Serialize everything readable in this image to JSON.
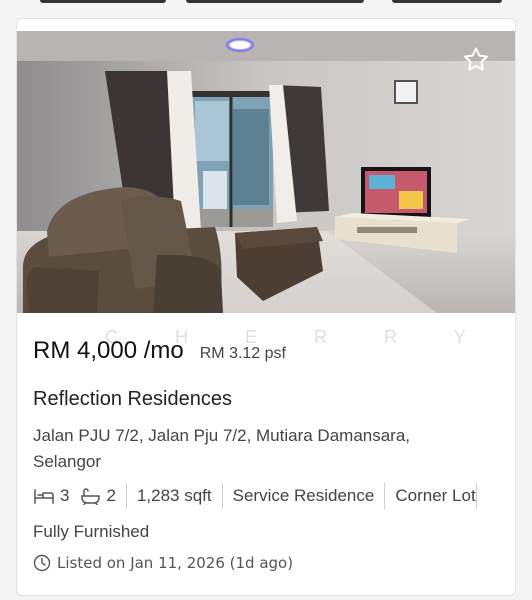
{
  "listing": {
    "price": "RM 4,000 /mo",
    "price_per_sqft": "RM 3.12 psf",
    "title": "Reflection Residences",
    "address": "Jalan PJU 7/2, Jalan Pju 7/2, Mutiara Damansara, Selangor",
    "bedrooms": "3",
    "bathrooms": "2",
    "size": "1,283 sqft",
    "property_type": "Service Residence",
    "lot_type": "Corner Lot",
    "furnishing": "Fully Furnished",
    "listed": "Listed on Jan 11, 2026 (1d ago)",
    "watermark": "C H E R R Y   T A N"
  },
  "icons": {
    "favorite": "star-outline-icon",
    "bed": "bed-icon",
    "bath": "bathtub-icon",
    "time": "clock-icon"
  },
  "colors": {
    "card_bg": "#ffffff",
    "page_bg": "#f4f4f5",
    "text_primary": "#222222",
    "text_secondary": "#444444",
    "divider": "#cfcfd3"
  }
}
